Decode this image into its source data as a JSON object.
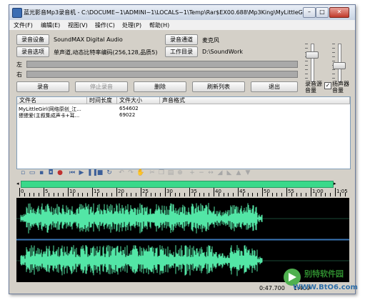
{
  "window": {
    "title": "蓝光影音Mp3录音机 - C:\\DOCUME~1\\ADMINI~1\\LOCALS~1\\Temp\\Rar$EX00.688\\Mp3King\\MyLittleGirl(...",
    "minimize": "–",
    "maximize": "□",
    "close": "✕"
  },
  "menu": [
    "文件(F)",
    "编辑(E)",
    "视图(V)",
    "操作(C)",
    "处理(P)",
    "帮助(H)"
  ],
  "settings": {
    "device_btn": "录音设备",
    "device_value": "SoundMAX Digital Audio",
    "source_btn": "录音通道",
    "source_value": "麦克风",
    "options_btn": "录音选项",
    "options_value": "单声道,动态比特率编码(256,128,品质5)",
    "workdir_btn": "工作目录",
    "workdir_value": "D:\\SoundWork",
    "left_label": "左",
    "right_label": "右"
  },
  "actions": {
    "record": "录音",
    "stop": "停止录音",
    "delete": "删除",
    "refresh": "刷新列表",
    "exit": "退出"
  },
  "volume": {
    "rec_label": "录音源音量",
    "spk_label": "扬声器音量",
    "spk_checked": true,
    "rec_level": 0.25,
    "spk_level": 0.6
  },
  "table": {
    "headers": [
      "文件名",
      "时间长度",
      "文件大小",
      "声音格式"
    ],
    "rows": [
      {
        "name": "MyLittleGirl(网络原创_江...",
        "length": "",
        "size": "654602",
        "format": ""
      },
      {
        "name": "猥猥爱(主叙集成声卡+耳...",
        "length": "",
        "size": "69022",
        "format": ""
      }
    ]
  },
  "toolbar_icons": [
    "new-icon",
    "open-icon",
    "save-icon",
    "save-as-icon",
    "record-icon",
    "rewind-icon",
    "play-icon",
    "pause-icon",
    "stop-icon",
    "loop-icon",
    "undo-icon",
    "redo-icon",
    "hand-icon",
    "cut-icon",
    "copy-icon",
    "paste-icon",
    "mix-icon",
    "zoom-in-icon",
    "zoom-out-icon",
    "zoom-fit-icon",
    "fade-in-icon",
    "fade-out-icon",
    "amplify-icon",
    "normalize-icon"
  ],
  "ruler": {
    "labels": [
      "0",
      "5",
      "10",
      "15",
      "20",
      "25",
      "30",
      "35",
      "40",
      "45",
      "50",
      "55",
      "1:00",
      "1:05"
    ]
  },
  "status": {
    "time": "0:47.700",
    "samples": "1:409"
  },
  "watermark": {
    "site_cn": "别特软件园",
    "site_en": "WWW.BtO6.com"
  },
  "colors": {
    "wave": "#53e6a6",
    "overview": "#39d98a"
  }
}
